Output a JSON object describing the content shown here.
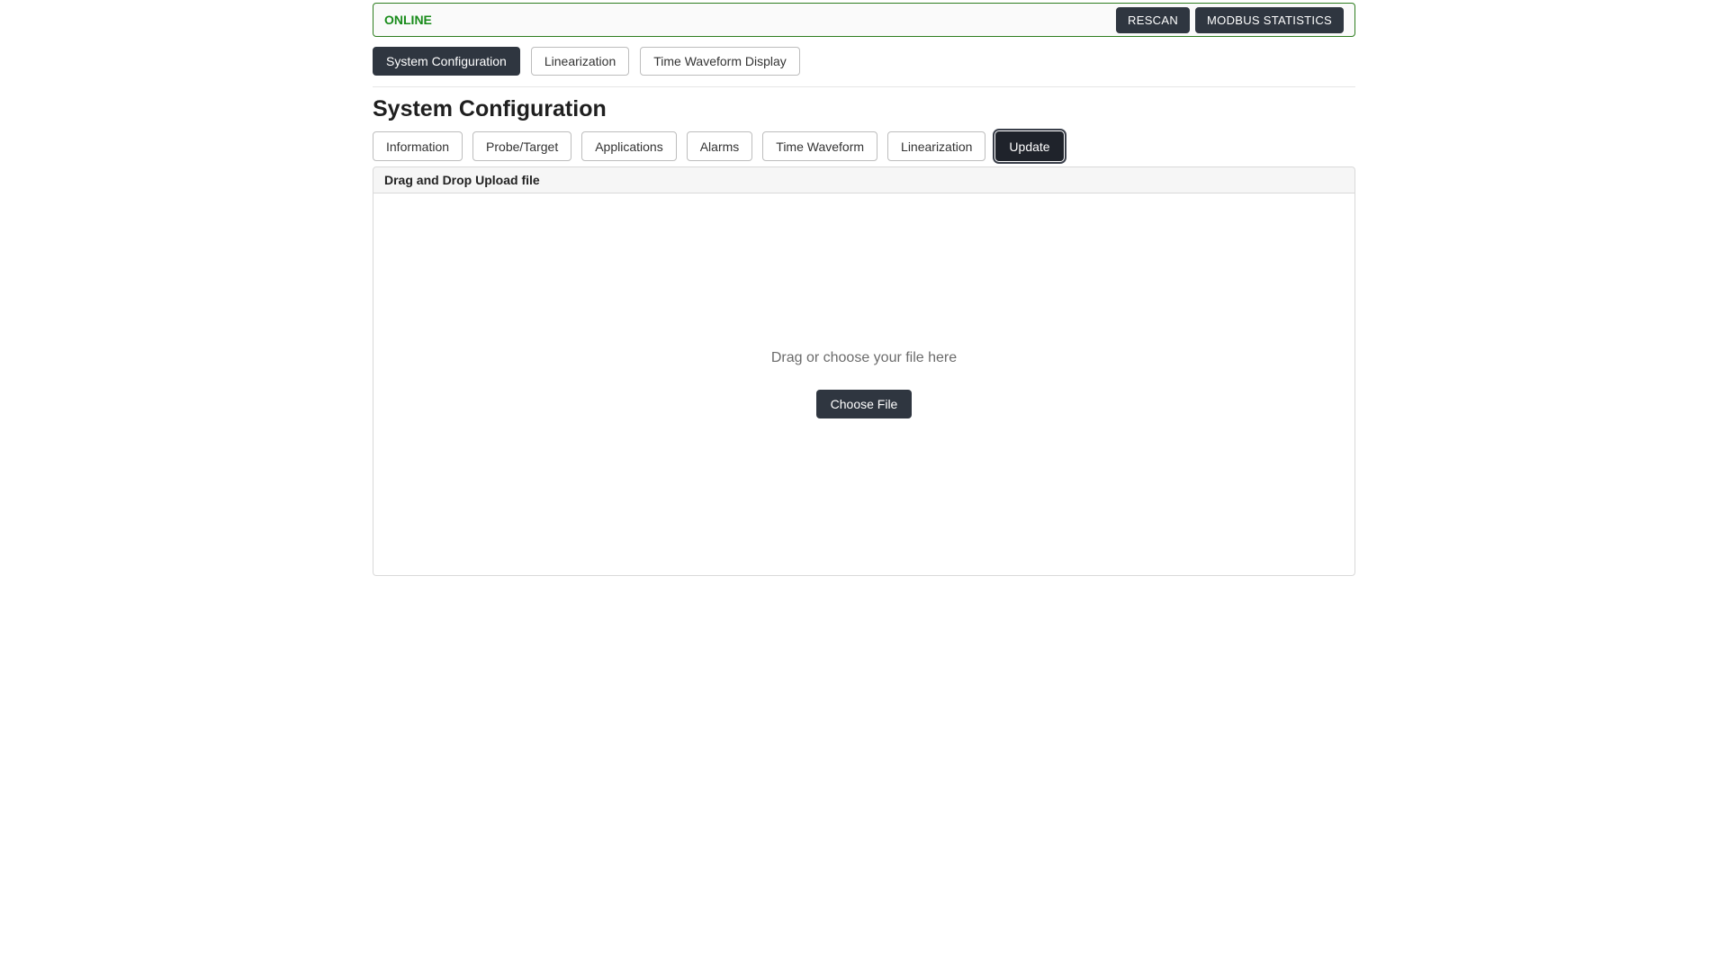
{
  "status_bar": {
    "status_label": "ONLINE",
    "rescan_label": "RESCAN",
    "modbus_stats_label": "MODBUS STATISTICS"
  },
  "main_tabs": [
    {
      "id": "system-config",
      "label": "System Configuration",
      "active": true
    },
    {
      "id": "linearization",
      "label": "Linearization",
      "active": false
    },
    {
      "id": "time-waveform-display",
      "label": "Time Waveform Display",
      "active": false
    }
  ],
  "page_title": "System Configuration",
  "sub_tabs": [
    {
      "id": "information",
      "label": "Information",
      "active": false
    },
    {
      "id": "probe-target",
      "label": "Probe/Target",
      "active": false
    },
    {
      "id": "applications",
      "label": "Applications",
      "active": false
    },
    {
      "id": "alarms",
      "label": "Alarms",
      "active": false
    },
    {
      "id": "time-waveform",
      "label": "Time Waveform",
      "active": false
    },
    {
      "id": "linearization-sub",
      "label": "Linearization",
      "active": false
    },
    {
      "id": "update",
      "label": "Update",
      "active": true
    }
  ],
  "upload_panel": {
    "header": "Drag and Drop Upload file",
    "drop_text": "Drag or choose your file here",
    "choose_file_label": "Choose File"
  }
}
